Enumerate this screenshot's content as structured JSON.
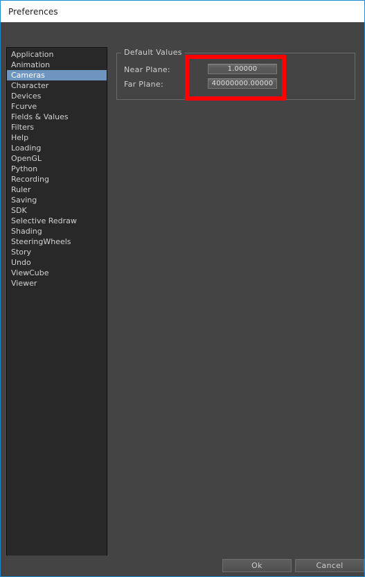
{
  "window": {
    "title": "Preferences",
    "accent_border": "#1b8ad4",
    "panel_bg": "#444444",
    "list_bg": "#282828",
    "selection_color": "#6e95bf",
    "annotation_color": "#fe0000"
  },
  "sidebar": {
    "selected": "Cameras",
    "items": [
      {
        "label": "Application"
      },
      {
        "label": "Animation"
      },
      {
        "label": "Cameras"
      },
      {
        "label": "Character"
      },
      {
        "label": "Devices"
      },
      {
        "label": "Fcurve"
      },
      {
        "label": "Fields & Values"
      },
      {
        "label": "Filters"
      },
      {
        "label": "Help"
      },
      {
        "label": "Loading"
      },
      {
        "label": "OpenGL"
      },
      {
        "label": "Python"
      },
      {
        "label": "Recording"
      },
      {
        "label": "Ruler"
      },
      {
        "label": "Saving"
      },
      {
        "label": "SDK"
      },
      {
        "label": "Selective Redraw"
      },
      {
        "label": "Shading"
      },
      {
        "label": "SteeringWheels"
      },
      {
        "label": "Story"
      },
      {
        "label": "Undo"
      },
      {
        "label": "ViewCube"
      },
      {
        "label": "Viewer"
      }
    ]
  },
  "main": {
    "group_title": "Default Values",
    "fields": [
      {
        "label": "Near Plane:",
        "value": "1.00000"
      },
      {
        "label": "Far Plane:",
        "value": "40000000.00000"
      }
    ]
  },
  "footer": {
    "ok_label": "Ok",
    "cancel_label": "Cancel"
  }
}
